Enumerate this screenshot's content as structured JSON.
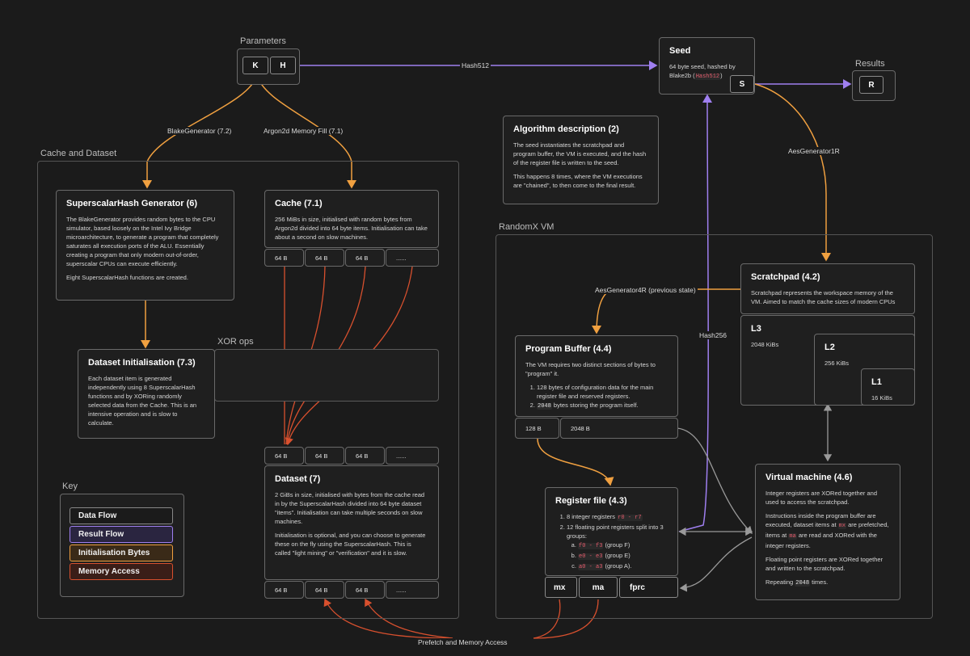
{
  "colors": {
    "data_flow": "#f0a040",
    "result_flow": "#9f7ff0",
    "memory_access": "#d8502e",
    "init_bytes": "#f0a040",
    "neutral": "#9a9a9a"
  },
  "parameters": {
    "label": "Parameters",
    "k": "K",
    "h": "H"
  },
  "seed": {
    "title": "Seed",
    "line1": "64 byte seed, hashed by",
    "line2_prefix": "Blake2b (",
    "line2_code": "Hash512",
    "line2_suffix": ")",
    "s": "S"
  },
  "results": {
    "label": "Results",
    "r": "R"
  },
  "edges": {
    "hash512": "Hash512",
    "blake_generator": "BlakeGenerator (7.2)",
    "argon2d": "Argon2d Memory Fill (7.1)",
    "aes_generator_1r": "AesGenerator1R",
    "aes_generator_4r": "AesGenerator4R (previous state)",
    "hash256": "Hash256",
    "prefetch": "Prefetch and Memory Access"
  },
  "algorithm": {
    "title": "Algorithm description (2)",
    "p1": "The seed instantiates the scratchpad and program buffer, the VM is executed, and the hash of the register file is written to the seed.",
    "p2": "This happens 8 times, where the VM executions are \"chained\", to then come to the final result."
  },
  "cache_dataset": {
    "label": "Cache and Dataset"
  },
  "superscalar": {
    "title": "SuperscalarHash Generator (6)",
    "p1": "The BlakeGenerator provides random bytes to the CPU simulator, based loosely on the Intel Ivy Bridge microarchitecture, to generate a program that completely saturates all execution ports of the ALU. Essentially creating a program that only modern out-of-order, superscalar CPUs can execute efficiently.",
    "p2": "Eight SuperscalarHash functions are created."
  },
  "cache": {
    "title": "Cache (7.1)",
    "p1": "256 MiBs in size, initialised with random bytes from Argon2d divided into 64 byte items. Initialisation can take about a second on slow machines.",
    "cells": [
      "64 B",
      "64 B",
      "64 B",
      "......"
    ]
  },
  "xor_ops": {
    "label": "XOR ops"
  },
  "dataset_init": {
    "title": "Dataset Initialisation (7.3)",
    "p1": "Each dataset item is generated independently using 8 SuperscalarHash functions and by XORing randomly selected data from the Cache. This is an intensive operation and is slow to calculate."
  },
  "dataset": {
    "title": "Dataset (7)",
    "p1": "2 GiBs in size, initialised with bytes from the cache read in by the SuperscalarHash divided into 64 byte dataset \"items\". Initialisation can take multiple seconds on slow machines.",
    "p2": "Initialisation is optional, and you can choose to generate these on the fly using the SuperscalarHash. This is called \"light mining\" or \"verification\" and it is slow.",
    "cells_top": [
      "64 B",
      "64 B",
      "64 B",
      "......"
    ],
    "cells_bottom": [
      "64 B",
      "64 B",
      "64 B",
      "......"
    ]
  },
  "key": {
    "label": "Key",
    "items": [
      "Data Flow",
      "Result Flow",
      "Initialisation Bytes",
      "Memory Access"
    ]
  },
  "vm_group": {
    "label": "RandomX VM"
  },
  "scratchpad": {
    "title": "Scratchpad (4.2)",
    "p1": "Scratchpad represents the workspace memory of the VM. Aimed to match the cache sizes of modern CPUs",
    "l3": "L3",
    "l3_size": "2048 KiBs",
    "l2": "L2",
    "l2_size": "256 KiBs",
    "l1": "L1",
    "l1_size": "16 KiBs"
  },
  "program_buffer": {
    "title": "Program Buffer (4.4)",
    "p1": "The VM requires two distinct sections of bytes to \"program\" it.",
    "li1": "128 bytes of configuration data for the main register file and reserved registers.",
    "li2_code": "2048",
    "li2_text": " bytes storing the program itself.",
    "cell1": "128 B",
    "cell2": "2048 B"
  },
  "register_file": {
    "title": "Register file (4.3)",
    "li1_text": "8 integer registers ",
    "li1_code": "r0 - r7",
    "li2_text": "12 floating point registers split into 3 groups:",
    "a_code": "f0 - f3",
    "a_text": " (group F)",
    "b_code": "e0 - e3",
    "b_text": " (group E)",
    "c_code": "a0 - a3",
    "c_text": " (group A).",
    "mx": "mx",
    "ma": "ma",
    "fprc": "fprc"
  },
  "vm": {
    "title": "Virtual machine (4.6)",
    "p1": "Integer registers are XORed together and used to access the scratchpad.",
    "p2_a": "Instructions inside the program buffer are executed, dataset items at ",
    "p2_code1": "mx",
    "p2_b": " are prefetched, items at ",
    "p2_code2": "ma",
    "p2_c": " are read and XORed with the integer registers.",
    "p3": "Floating point registers are XORed together and written to the scratchpad.",
    "p4_a": "Repeating ",
    "p4_code": "2048",
    "p4_b": " times."
  }
}
